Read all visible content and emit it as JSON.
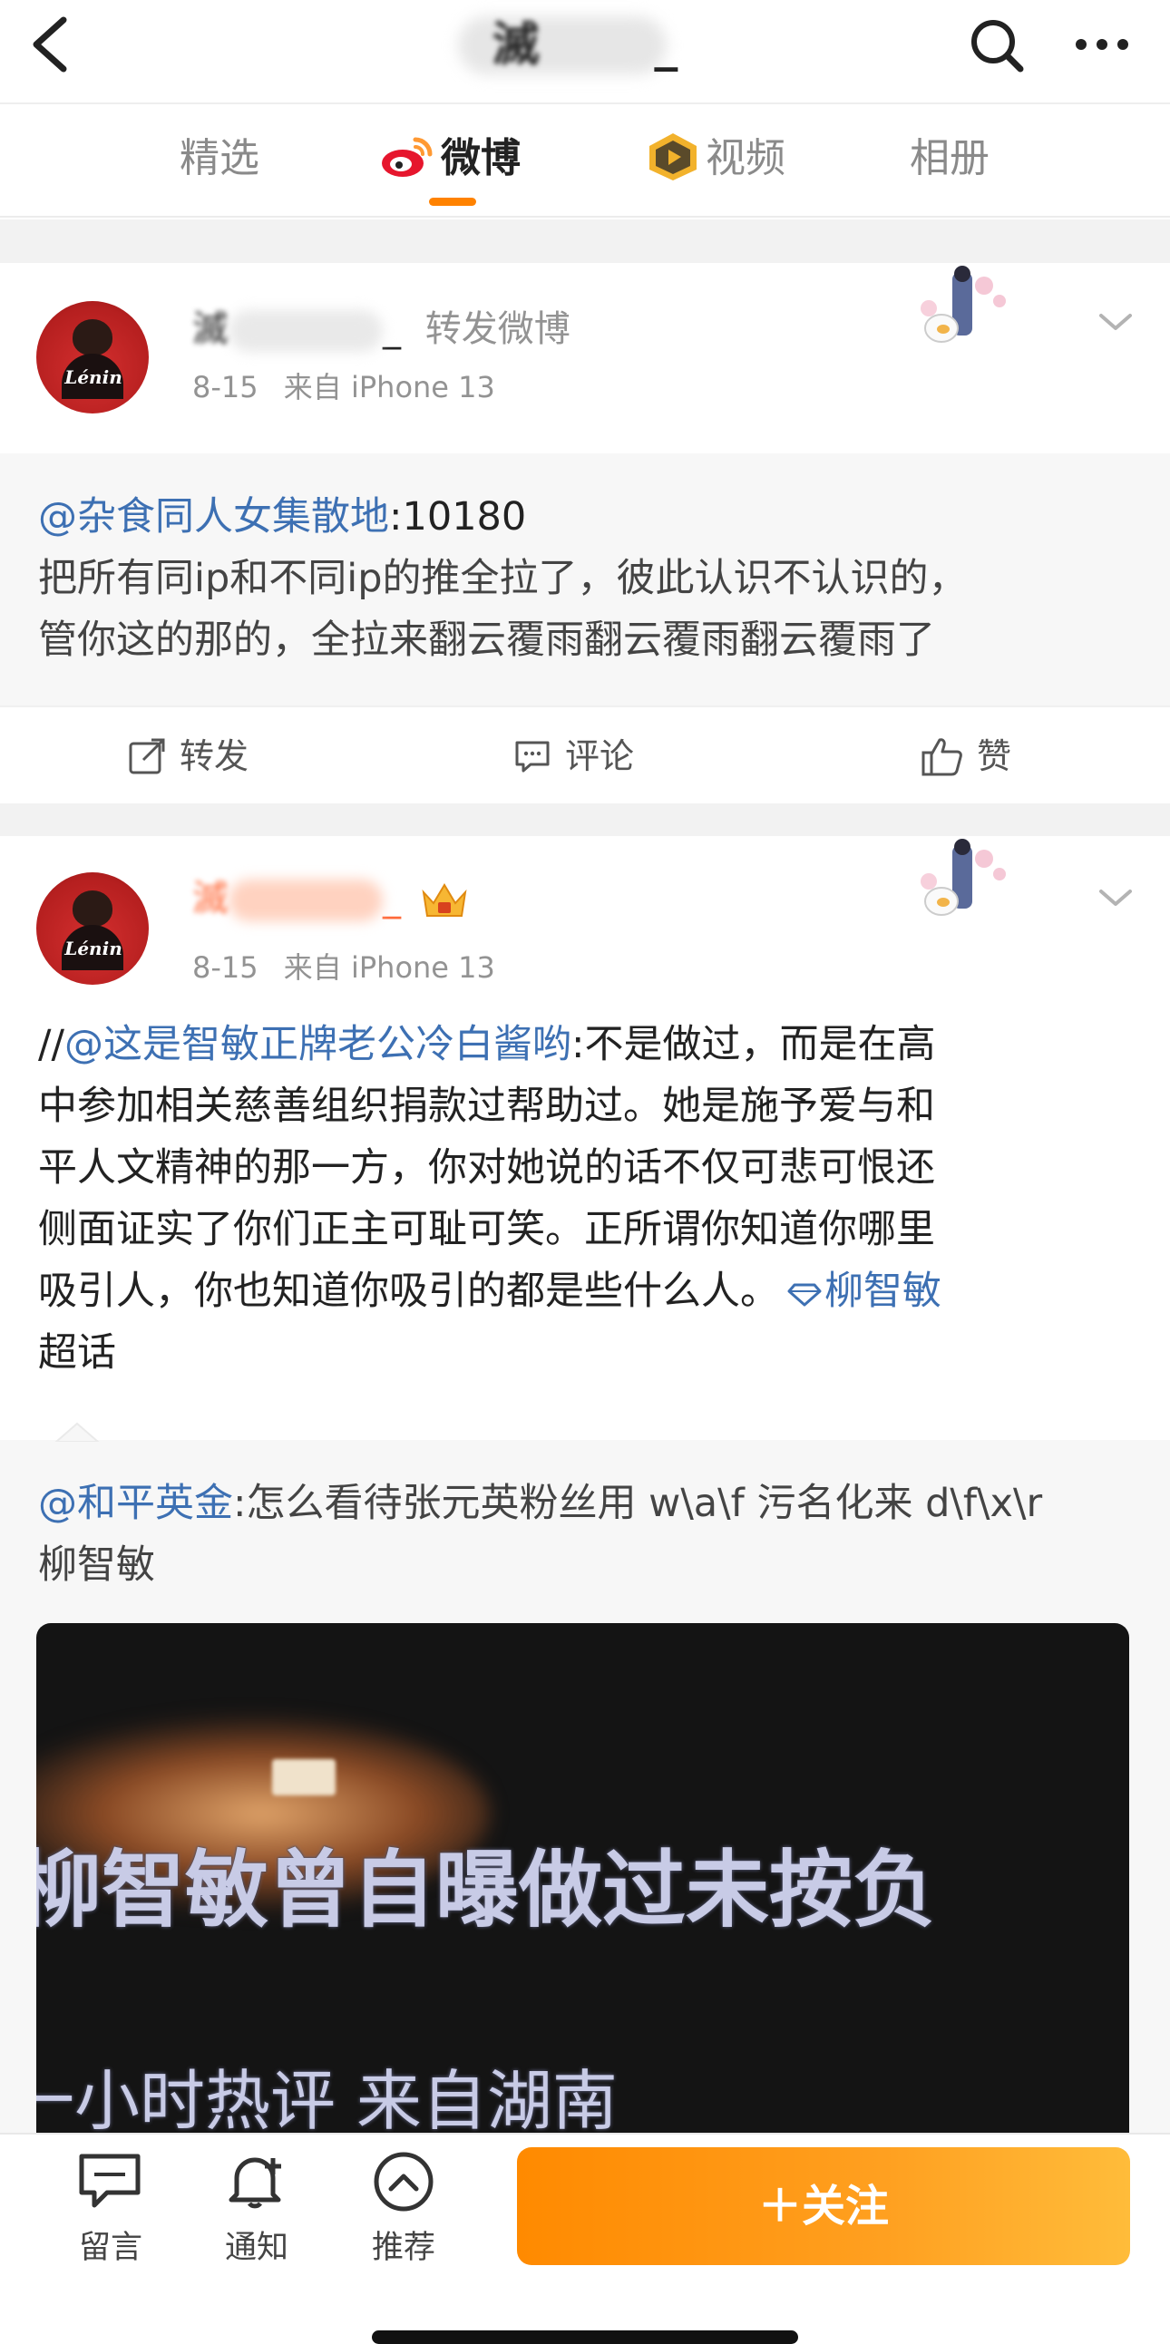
{
  "header": {
    "title": "       _",
    "title_prefix": "滅"
  },
  "tabs": [
    {
      "label": "精选",
      "active": false
    },
    {
      "label": "微博",
      "active": true
    },
    {
      "label": "视频",
      "active": false
    },
    {
      "label": "相册",
      "active": false
    }
  ],
  "post1": {
    "author_suffix": "_",
    "author_prefix": "滅",
    "action_text": "转发微博",
    "date": "8-15",
    "source": "来自 iPhone 13",
    "avatar_caption": "Lénin",
    "mention": "@杂食同人女集散地",
    "mention_suffix": ":10180",
    "line1": "把所有同ip和不同ip的推全拉了，彼此认识不认识的，",
    "line2": "管你这的那的，全拉来翻云覆雨翻云覆雨翻云覆雨了"
  },
  "actions": {
    "repost": "转发",
    "comment": "评论",
    "like": "赞"
  },
  "post2": {
    "author_suffix": "_",
    "author_prefix": "滅",
    "date": "8-15",
    "source": "来自 iPhone 13",
    "avatar_caption": "Lénin",
    "slashes": "//",
    "mention": "@这是智敏正牌老公冷白酱哟",
    "line1_rest": ":不是做过，而是在高",
    "line2": "中参加相关慈善组织捐款过帮助过。她是施予爱与和",
    "line3": "平人文精神的那一方，你对她说的话不仅可悲可恨还",
    "line4": "侧面证实了你们正主可耻可笑。正所谓你知道你哪里",
    "line5_text": "吸引人，你也知道你吸引的都是些什么人。",
    "topic": "柳智敏",
    "topic_tail": "超话",
    "quote_mention": "@和平英金",
    "quote_line1_rest": ":怎么看待张元英粉丝用 w\\a\\f 污名化来 d\\f\\x\\r",
    "quote_line2": "柳智敏",
    "video_caption": "柳智敏曾自曝做过未按负",
    "video_caption2": "一小时热评  来自湖南"
  },
  "bottom_bar": {
    "message": "留言",
    "notify": "通知",
    "recommend": "推荐",
    "follow": "＋关注"
  },
  "colors": {
    "accent": "#ff8200",
    "link": "#3d70b3"
  }
}
